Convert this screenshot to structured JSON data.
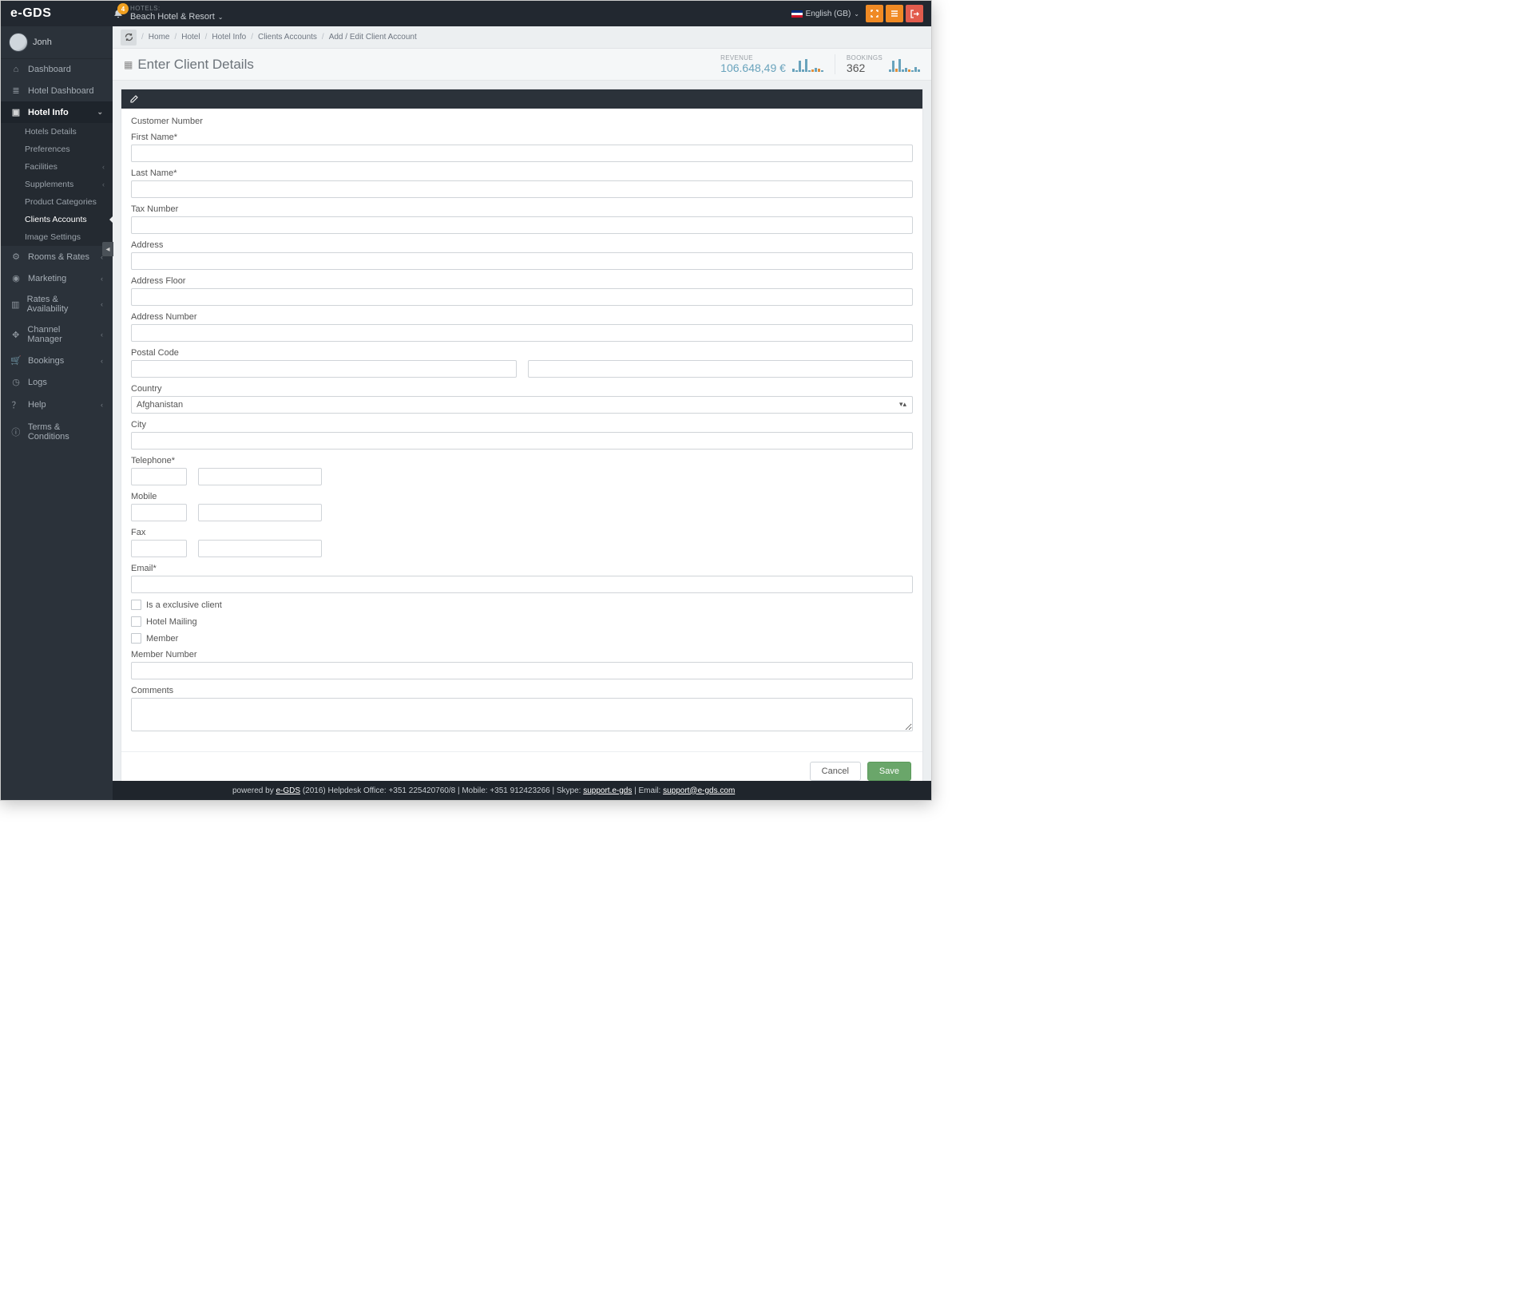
{
  "app_name": "e-GDS",
  "notification_count": "4",
  "hotels_label": "HOTELS:",
  "hotel_name": "Beach Hotel & Resort",
  "language": "English (GB)",
  "user_name": "Jonh",
  "sidebar": {
    "items": [
      {
        "icon": "home",
        "label": "Dashboard"
      },
      {
        "icon": "list",
        "label": "Hotel Dashboard"
      },
      {
        "icon": "clip",
        "label": "Hotel Info",
        "active": true
      },
      {
        "icon": "cog",
        "label": "Rooms & Rates",
        "chev": true
      },
      {
        "icon": "target",
        "label": "Marketing",
        "chev": true
      },
      {
        "icon": "bar",
        "label": "Rates & Availability",
        "chev": true
      },
      {
        "icon": "move",
        "label": "Channel Manager",
        "chev": true
      },
      {
        "icon": "cart",
        "label": "Bookings",
        "chev": true
      },
      {
        "icon": "clock",
        "label": "Logs"
      },
      {
        "icon": "help",
        "label": "Help",
        "chev": true
      },
      {
        "icon": "info",
        "label": "Terms & Conditions"
      }
    ],
    "sub": [
      {
        "label": "Hotels Details"
      },
      {
        "label": "Preferences"
      },
      {
        "label": "Facilities",
        "chev": true
      },
      {
        "label": "Supplements",
        "chev": true
      },
      {
        "label": "Product Categories"
      },
      {
        "label": "Clients Accounts",
        "active": true
      },
      {
        "label": "Image Settings"
      }
    ]
  },
  "breadcrumb": [
    "Home",
    "Hotel",
    "Hotel Info",
    "Clients Accounts",
    "Add / Edit Client Account"
  ],
  "title": "Enter Client Details",
  "stats": {
    "revenue_label": "REVENUE",
    "revenue_value": "106.648,49 €",
    "bookings_label": "BOOKINGS",
    "bookings_value": "362"
  },
  "form": {
    "customer_number": "Customer Number",
    "first_name": "First Name*",
    "last_name": "Last Name*",
    "tax_number": "Tax Number",
    "address": "Address",
    "address_floor": "Address Floor",
    "address_number": "Address Number",
    "postal_code": "Postal Code",
    "country": "Country",
    "country_value": "Afghanistan",
    "city": "City",
    "telephone": "Telephone*",
    "mobile": "Mobile",
    "fax": "Fax",
    "email": "Email*",
    "exclusive": "Is a exclusive client",
    "hotel_mailing": "Hotel Mailing",
    "member": "Member",
    "member_number": "Member Number",
    "comments": "Comments",
    "cancel": "Cancel",
    "save": "Save"
  },
  "footer": {
    "powered": "powered by ",
    "brand": "e-GDS",
    "rest": " (2016) Helpdesk Office: +351 225420760/8 | Mobile: +351 912423266 | Skype: ",
    "skype": "support.e-gds",
    "email_label": " | Email: ",
    "email": "support@e-gds.com"
  }
}
